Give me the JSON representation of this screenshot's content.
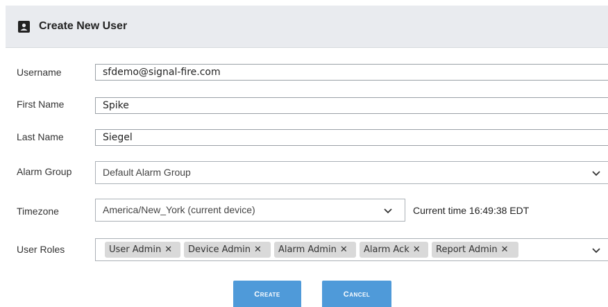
{
  "dialog": {
    "title": "Create New User",
    "icon": "user-card-icon"
  },
  "fields": {
    "username": {
      "label": "Username",
      "value": "sfdemo@signal-fire.com"
    },
    "first_name": {
      "label": "First Name",
      "value": "Spike"
    },
    "last_name": {
      "label": "Last Name",
      "value": "Siegel"
    },
    "alarm_group": {
      "label": "Alarm Group",
      "value": "Default Alarm Group"
    },
    "timezone": {
      "label": "Timezone",
      "value": "America/New_York (current device)",
      "current_time": "Current time 16:49:38 EDT"
    },
    "user_roles": {
      "label": "User Roles",
      "selected": [
        "User Admin",
        "Device Admin",
        "Alarm Admin",
        "Alarm Ack",
        "Report Admin"
      ]
    }
  },
  "buttons": {
    "create": "Create",
    "cancel": "Cancel"
  },
  "colors": {
    "header_bg": "#e9ebef",
    "button_bg": "#4f9ad9",
    "tag_bg": "#d9d9d9"
  }
}
